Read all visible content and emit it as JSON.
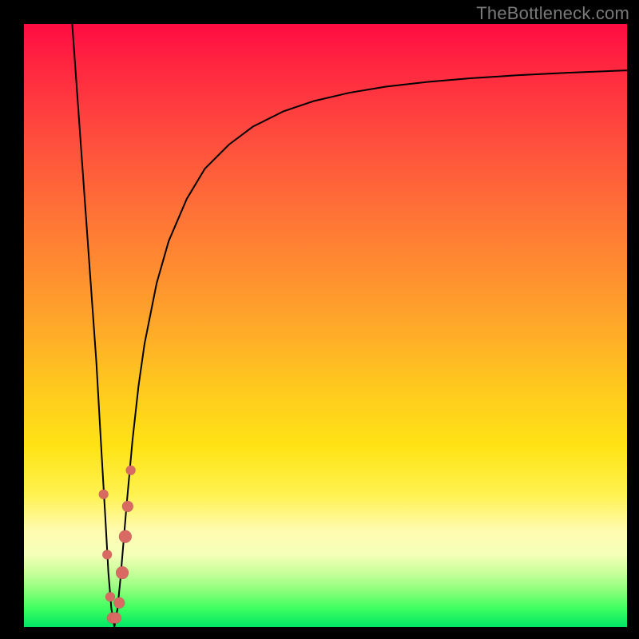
{
  "watermark": "TheBottleneck.com",
  "chart_data": {
    "type": "line",
    "title": "",
    "xlabel": "",
    "ylabel": "",
    "xlim": [
      0,
      100
    ],
    "ylim": [
      0,
      100
    ],
    "grid": false,
    "legend": false,
    "background": {
      "type": "vertical-gradient",
      "stops": [
        {
          "pos": 0.0,
          "color": "#ff0b43"
        },
        {
          "pos": 0.18,
          "color": "#ff4a3e"
        },
        {
          "pos": 0.48,
          "color": "#ffa22b"
        },
        {
          "pos": 0.7,
          "color": "#ffe315"
        },
        {
          "pos": 0.84,
          "color": "#fffbb0"
        },
        {
          "pos": 0.94,
          "color": "#8aff7a"
        },
        {
          "pos": 1.0,
          "color": "#00e565"
        }
      ]
    },
    "series": [
      {
        "name": "bottleneck-curve",
        "color": "#000000",
        "x": [
          8.0,
          9.0,
          10.0,
          11.0,
          12.0,
          12.8,
          13.5,
          14.0,
          14.5,
          15.0,
          15.5,
          16.0,
          16.5,
          17.0,
          18.0,
          19.0,
          20.0,
          22.0,
          24.0,
          27.0,
          30.0,
          34.0,
          38.0,
          43.0,
          48.0,
          54.0,
          60.0,
          67.0,
          74.0,
          82.0,
          90.0,
          100.0
        ],
        "y": [
          100.0,
          86.0,
          72.0,
          58.0,
          44.0,
          30.0,
          18.0,
          9.0,
          3.0,
          0.0,
          3.0,
          8.0,
          14.0,
          20.0,
          31.0,
          40.0,
          47.0,
          57.0,
          64.0,
          71.0,
          76.0,
          80.0,
          83.0,
          85.5,
          87.2,
          88.6,
          89.6,
          90.4,
          91.0,
          91.5,
          91.9,
          92.3
        ]
      }
    ],
    "markers": {
      "name": "highlight-points",
      "color": "#d86a63",
      "points": [
        {
          "x": 13.2,
          "y": 22.0,
          "r": 6
        },
        {
          "x": 13.8,
          "y": 12.0,
          "r": 6
        },
        {
          "x": 14.3,
          "y": 5.0,
          "r": 6
        },
        {
          "x": 14.7,
          "y": 1.5,
          "r": 7
        },
        {
          "x": 15.2,
          "y": 1.5,
          "r": 7
        },
        {
          "x": 15.8,
          "y": 4.0,
          "r": 7
        },
        {
          "x": 16.3,
          "y": 9.0,
          "r": 8
        },
        {
          "x": 16.8,
          "y": 15.0,
          "r": 8
        },
        {
          "x": 17.2,
          "y": 20.0,
          "r": 7
        },
        {
          "x": 17.7,
          "y": 26.0,
          "r": 6
        }
      ]
    }
  }
}
